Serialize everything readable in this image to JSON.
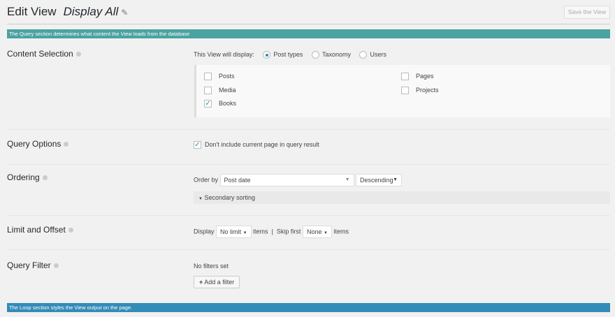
{
  "header": {
    "title": "Edit View",
    "view_name": "Display All",
    "save_label": "Save the View"
  },
  "query_banner": "The Query section determines what content the View loads from the database",
  "loop_banner": "The Loop section styles the View output on the page.",
  "colors": {
    "query_banner": "#4aa3a0",
    "loop_banner": "#338bb8"
  },
  "content_selection": {
    "label": "Content Selection",
    "display_label": "This View will display:",
    "radios": [
      {
        "label": "Post types",
        "checked": true
      },
      {
        "label": "Taxonomy",
        "checked": false
      },
      {
        "label": "Users",
        "checked": false
      }
    ],
    "post_types": [
      {
        "label": "Posts",
        "checked": false
      },
      {
        "label": "Media",
        "checked": false
      },
      {
        "label": "Books",
        "checked": true
      },
      {
        "label": "Pages",
        "checked": false
      },
      {
        "label": "Projects",
        "checked": false
      }
    ]
  },
  "query_options": {
    "label": "Query Options",
    "checkbox_label": "Don't include current page in query result",
    "checked": true
  },
  "ordering": {
    "label": "Ordering",
    "order_by_label": "Order by",
    "order_by_value": "Post date",
    "direction_value": "Descending",
    "secondary_label": "Secondary sorting"
  },
  "limit": {
    "label": "Limit and Offset",
    "display_label": "Display",
    "limit_value": "No limit",
    "items_label": "items",
    "separator": "|",
    "skip_label": "Skip first",
    "skip_value": "None",
    "items_label2": "items"
  },
  "filter": {
    "label": "Query Filter",
    "no_filters": "No filters set",
    "add_label": "Add a filter"
  }
}
